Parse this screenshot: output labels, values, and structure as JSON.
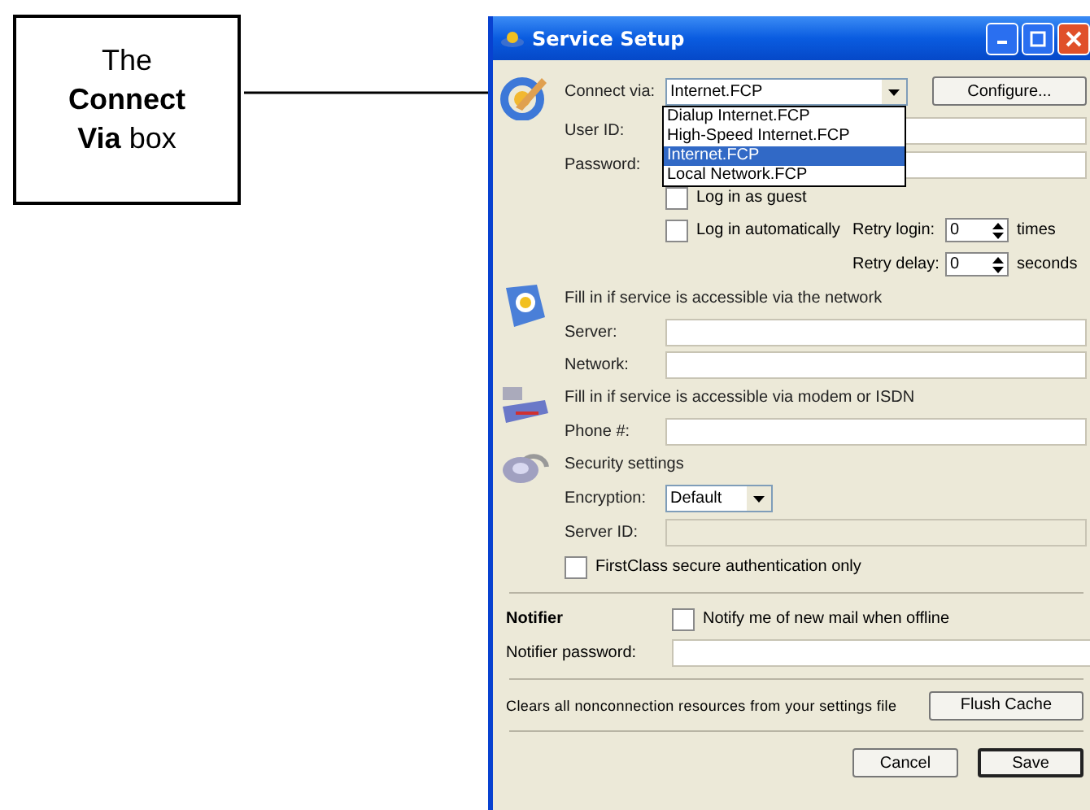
{
  "callout": {
    "text": "The **Connect Via** box"
  },
  "window": {
    "title": "Service Setup"
  },
  "connect": {
    "label": "Connect via:",
    "value": "Internet.FCP",
    "expanded": true,
    "configure_button": "Configure...",
    "options": [
      {
        "label": "Dialup Internet.FCP",
        "selected": false
      },
      {
        "label": "High-Speed Internet.FCP",
        "selected": false
      },
      {
        "label": "Internet.FCP",
        "selected": true
      },
      {
        "label": "Local Network.FCP",
        "selected": false
      }
    ]
  },
  "login_fields": [
    {
      "label": "User ID:"
    },
    {
      "label": "Password:"
    }
  ],
  "guest": {
    "label": "Log in as guest",
    "checked": false
  },
  "auto": {
    "label": "Log in automatically",
    "checked": false
  },
  "retry": [
    {
      "label": "Retry login:",
      "value": "0",
      "unit": "times"
    },
    {
      "label": "Retry delay:",
      "value": "0",
      "unit": "seconds"
    }
  ],
  "network": {
    "heading": "Fill in if service is accessible via the network",
    "fields": [
      {
        "label": "Server:"
      },
      {
        "label": "Network:"
      }
    ]
  },
  "modem": {
    "heading": "Fill in if service is accessible via modem or ISDN",
    "fields": [
      {
        "label": "Phone #:"
      }
    ]
  },
  "security": {
    "heading": "Security settings",
    "encryption": {
      "label": "Encryption:",
      "value": "Default"
    },
    "server_id": {
      "label": "Server ID:",
      "disabled": true
    },
    "secure_auth": {
      "label": "FirstClass secure authentication only",
      "checked": false
    }
  },
  "notifier": {
    "heading": "Notifier",
    "notify": {
      "label": "Notify me of new mail when offline",
      "checked": false
    },
    "password": {
      "label": "Notifier password:"
    }
  },
  "cache": {
    "text": "Clears all nonconnection resources from your settings file",
    "button": "Flush Cache"
  },
  "buttons": [
    {
      "label": "Cancel",
      "default": false
    },
    {
      "label": "Save",
      "default": true
    }
  ]
}
